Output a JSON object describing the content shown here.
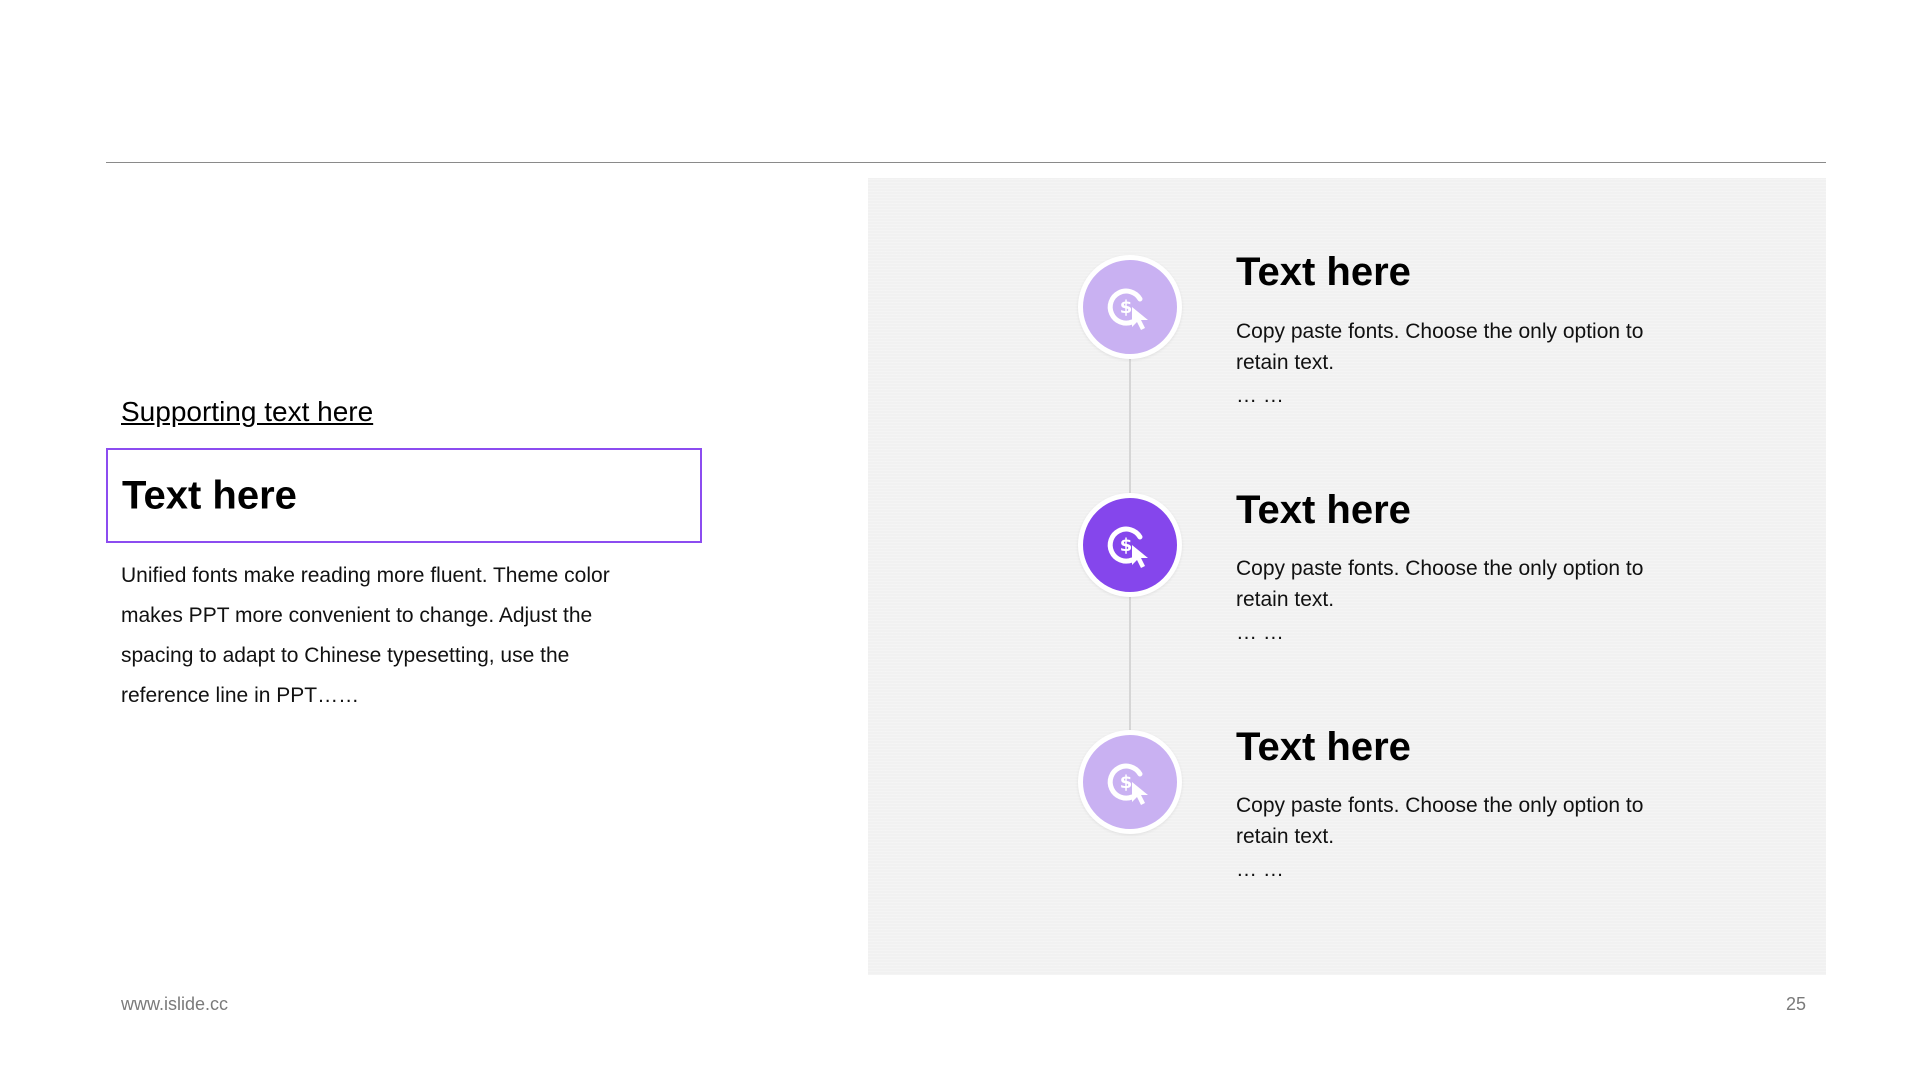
{
  "left": {
    "supporting_text": "Supporting text here",
    "title": "Text here",
    "body": "Unified fonts make reading more fluent. Theme color makes PPT more convenient to change. Adjust the spacing to adapt to Chinese typesetting, use the reference line in PPT……"
  },
  "steps": [
    {
      "heading": "Text here",
      "desc": "Copy paste fonts. Choose the only option to retain text.",
      "ellipsis": "… …",
      "icon": "dollar-click-icon",
      "circle_color": "#c9b1f2"
    },
    {
      "heading": "Text here",
      "desc": "Copy paste fonts. Choose the only option to retain text.",
      "ellipsis": "… …",
      "icon": "dollar-click-icon",
      "circle_color": "#8546ec"
    },
    {
      "heading": "Text here",
      "desc": "Copy paste fonts. Choose the only option to retain text.",
      "ellipsis": "… …",
      "icon": "dollar-click-icon",
      "circle_color": "#c9b1f2"
    }
  ],
  "colors": {
    "accent": "#8c4cf0",
    "panel_bg": "#f1f1f1"
  },
  "footer": {
    "url": "www.islide.cc",
    "page_number": "25"
  }
}
